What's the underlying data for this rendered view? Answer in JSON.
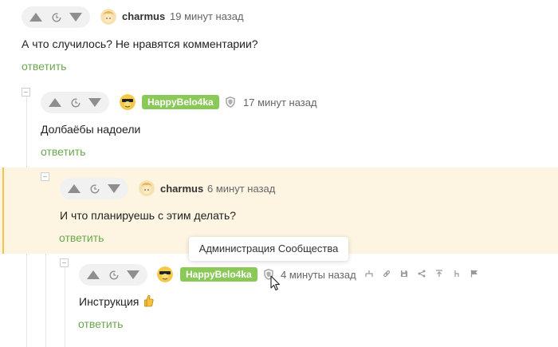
{
  "comments": [
    {
      "username": "charmus",
      "time": "19 минут назад",
      "text": "А что случилось? Не нравятся комментарии?",
      "reply_label": "ответить"
    },
    {
      "username": "HappyBelo4ka",
      "time": "17 минут назад",
      "text": "Долбаёбы надоели",
      "reply_label": "ответить"
    },
    {
      "username": "charmus",
      "time": "6 минут назад",
      "text": "И что планируешь с этим делать?",
      "reply_label": "ответить"
    },
    {
      "username": "HappyBelo4ka",
      "time": "4 минуты назад",
      "text": "Инструкция",
      "reply_label": "ответить"
    }
  ],
  "tooltip": "Администрация Сообщества",
  "colors": {
    "accent_green": "#6aa84f",
    "badge_green": "#8ac858",
    "highlight_bg": "#fdf5e1",
    "highlight_bar": "#f2c14e"
  },
  "icons": {
    "vote_up": "triangle-up-icon",
    "vote_down": "triangle-down-icon",
    "vote_rating": "clock-icon",
    "admin_shield": "shield-icon",
    "tools": [
      "branch-icon",
      "link-icon",
      "save-icon",
      "share-icon",
      "pin-icon",
      "tree-icon",
      "flag-icon"
    ]
  }
}
